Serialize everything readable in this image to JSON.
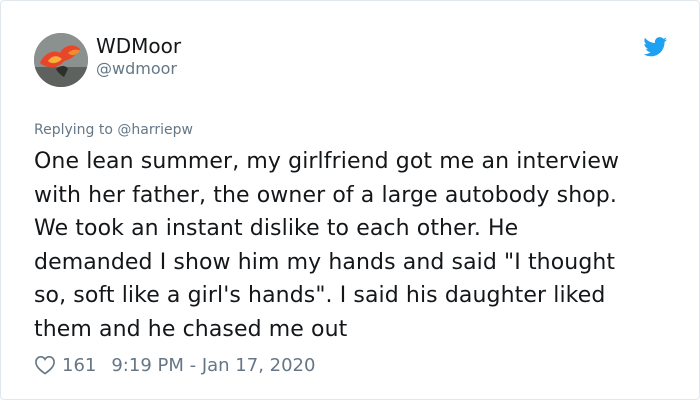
{
  "author": {
    "display_name": "WDMoor",
    "handle": "@wdmoor",
    "avatar_icon": "avatar-image"
  },
  "platform_icon": "twitter-bird-icon",
  "reply_to": "Replying to @harriepw",
  "tweet": {
    "lines": [
      "One lean summer, my girlfriend got me an interview",
      "with her father, the owner of a large autobody shop.",
      "We took an instant dislike to each other. He",
      "demanded I show him my hands and said \"I thought",
      "so, soft like a girl's hands\". I said his daughter liked",
      "them and he chased me out"
    ]
  },
  "footer": {
    "like_icon": "heart-icon",
    "like_count": "161",
    "timestamp": "9:19 PM - Jan 17, 2020"
  },
  "colors": {
    "text": "#14171a",
    "secondary": "#657786",
    "brand": "#1da1f2",
    "border": "#e1e8ed"
  }
}
